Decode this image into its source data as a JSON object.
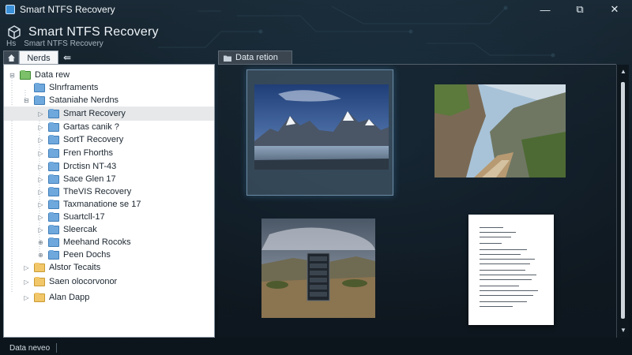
{
  "window": {
    "title": "Smart NTFS Recovery",
    "minimize_glyph": "—",
    "maximize_glyph": "⧉",
    "close_glyph": "✕"
  },
  "header": {
    "title": "Smart NTFS Recovery",
    "subtitle_prefix": "Hs",
    "subtitle": "Smart NTFS Recovery"
  },
  "left_panel": {
    "tab_label": "Nerds",
    "back_glyph": "⇚",
    "tree": [
      {
        "label": "Data rew",
        "folder": "green",
        "expander": "⊟"
      },
      {
        "label": "Slnrframents",
        "folder": "blue",
        "expander": ""
      },
      {
        "label": "Sataniahe Nerdns",
        "folder": "blue",
        "expander": "⊟"
      },
      {
        "label": "Smart Recovery",
        "folder": "blue",
        "expander": "▷"
      },
      {
        "label": "Gartas canik ?",
        "folder": "blue",
        "expander": "▷"
      },
      {
        "label": "SortT Recovery",
        "folder": "blue",
        "expander": "▷"
      },
      {
        "label": "Fren Fhorths",
        "folder": "blue",
        "expander": "▷"
      },
      {
        "label": "Drctisn NT-43",
        "folder": "blue",
        "expander": "▷"
      },
      {
        "label": "Sace Glen 17",
        "folder": "blue",
        "expander": "▷"
      },
      {
        "label": "TheVIS Recovery",
        "folder": "blue",
        "expander": "▷"
      },
      {
        "label": "Taxmanatione se 17",
        "folder": "blue",
        "expander": "▷"
      },
      {
        "label": "Suartcll-17",
        "folder": "blue",
        "expander": "▷"
      },
      {
        "label": "Sleercak",
        "folder": "blue",
        "expander": "▷"
      },
      {
        "label": "Meehand Rocoks",
        "folder": "blue",
        "expander": "⊕"
      },
      {
        "label": "Peen Dochs",
        "folder": "blue",
        "expander": "⊕"
      },
      {
        "label": "Alstor Tecaits",
        "folder": "yellow",
        "expander": "▷"
      },
      {
        "label": "Saen olocorvonor",
        "folder": "yellow",
        "expander": "▷"
      },
      {
        "label": "Alan Dapp",
        "folder": "yellow",
        "expander": "▷"
      }
    ]
  },
  "right_panel": {
    "tab_label": "Data retion"
  },
  "status": {
    "text": "Data neveo"
  }
}
